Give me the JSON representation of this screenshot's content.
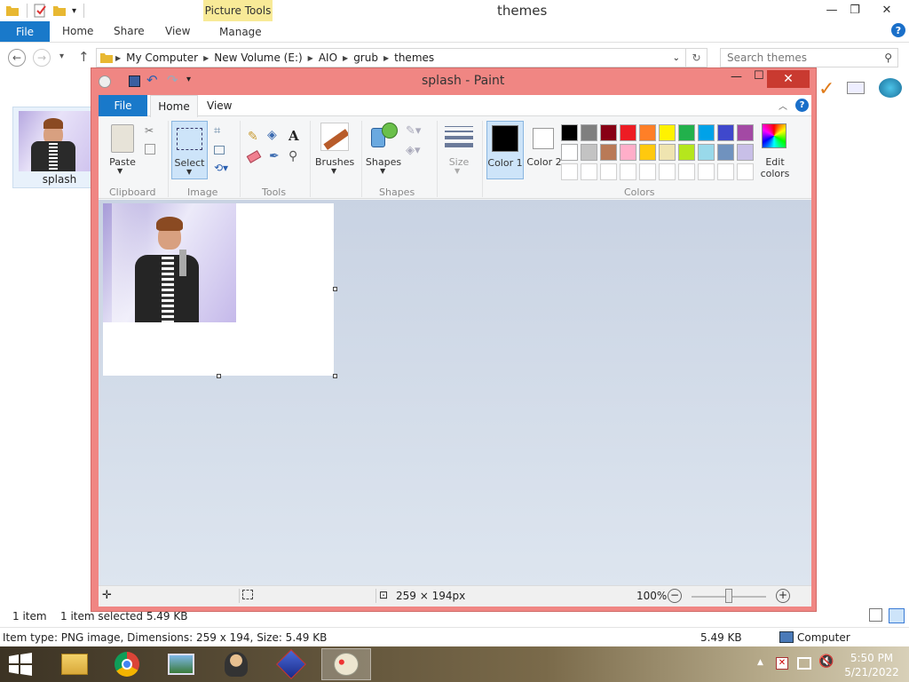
{
  "explorer": {
    "title": "themes",
    "picture_tools": "Picture Tools",
    "tabs": {
      "file": "File",
      "home": "Home",
      "share": "Share",
      "view": "View",
      "manage": "Manage"
    },
    "address": [
      "My Computer",
      "New Volume (E:)",
      "AIO",
      "grub",
      "themes"
    ],
    "search_placeholder": "Search themes",
    "file_item": {
      "name": "splash"
    },
    "status": {
      "count": "1 item",
      "selected": "1 item selected  5.49 KB"
    },
    "details": {
      "info": "Item type: PNG image, Dimensions: 259 x 194, Size: 5.49 KB",
      "size": "5.49 KB",
      "location": "Computer"
    }
  },
  "paint": {
    "title": "splash - Paint",
    "tabs": {
      "file": "File",
      "home": "Home",
      "view": "View"
    },
    "ribbon": {
      "paste": "Paste",
      "select": "Select",
      "brushes": "Brushes",
      "shapes": "Shapes",
      "size": "Size",
      "color1": "Color 1",
      "color2": "Color 2",
      "edit_colors": "Edit colors",
      "groups": {
        "clipboard": "Clipboard",
        "image": "Image",
        "tools": "Tools",
        "shapes": "Shapes",
        "colors": "Colors"
      }
    },
    "palette_row1": [
      "#000000",
      "#7f7f7f",
      "#880015",
      "#ed1c24",
      "#ff7f27",
      "#fff200",
      "#22b14c",
      "#00a2e8",
      "#3f48cc",
      "#a349a4"
    ],
    "palette_row2": [
      "#ffffff",
      "#c3c3c3",
      "#b97a57",
      "#ffaec9",
      "#ffc90e",
      "#efe4b0",
      "#b5e61d",
      "#99d9ea",
      "#7092be",
      "#c8bfe7"
    ],
    "status": {
      "dimensions": "259 × 194px",
      "zoom": "100%"
    }
  },
  "taskbar": {
    "time": "5:50 PM",
    "date": "5/21/2022"
  }
}
